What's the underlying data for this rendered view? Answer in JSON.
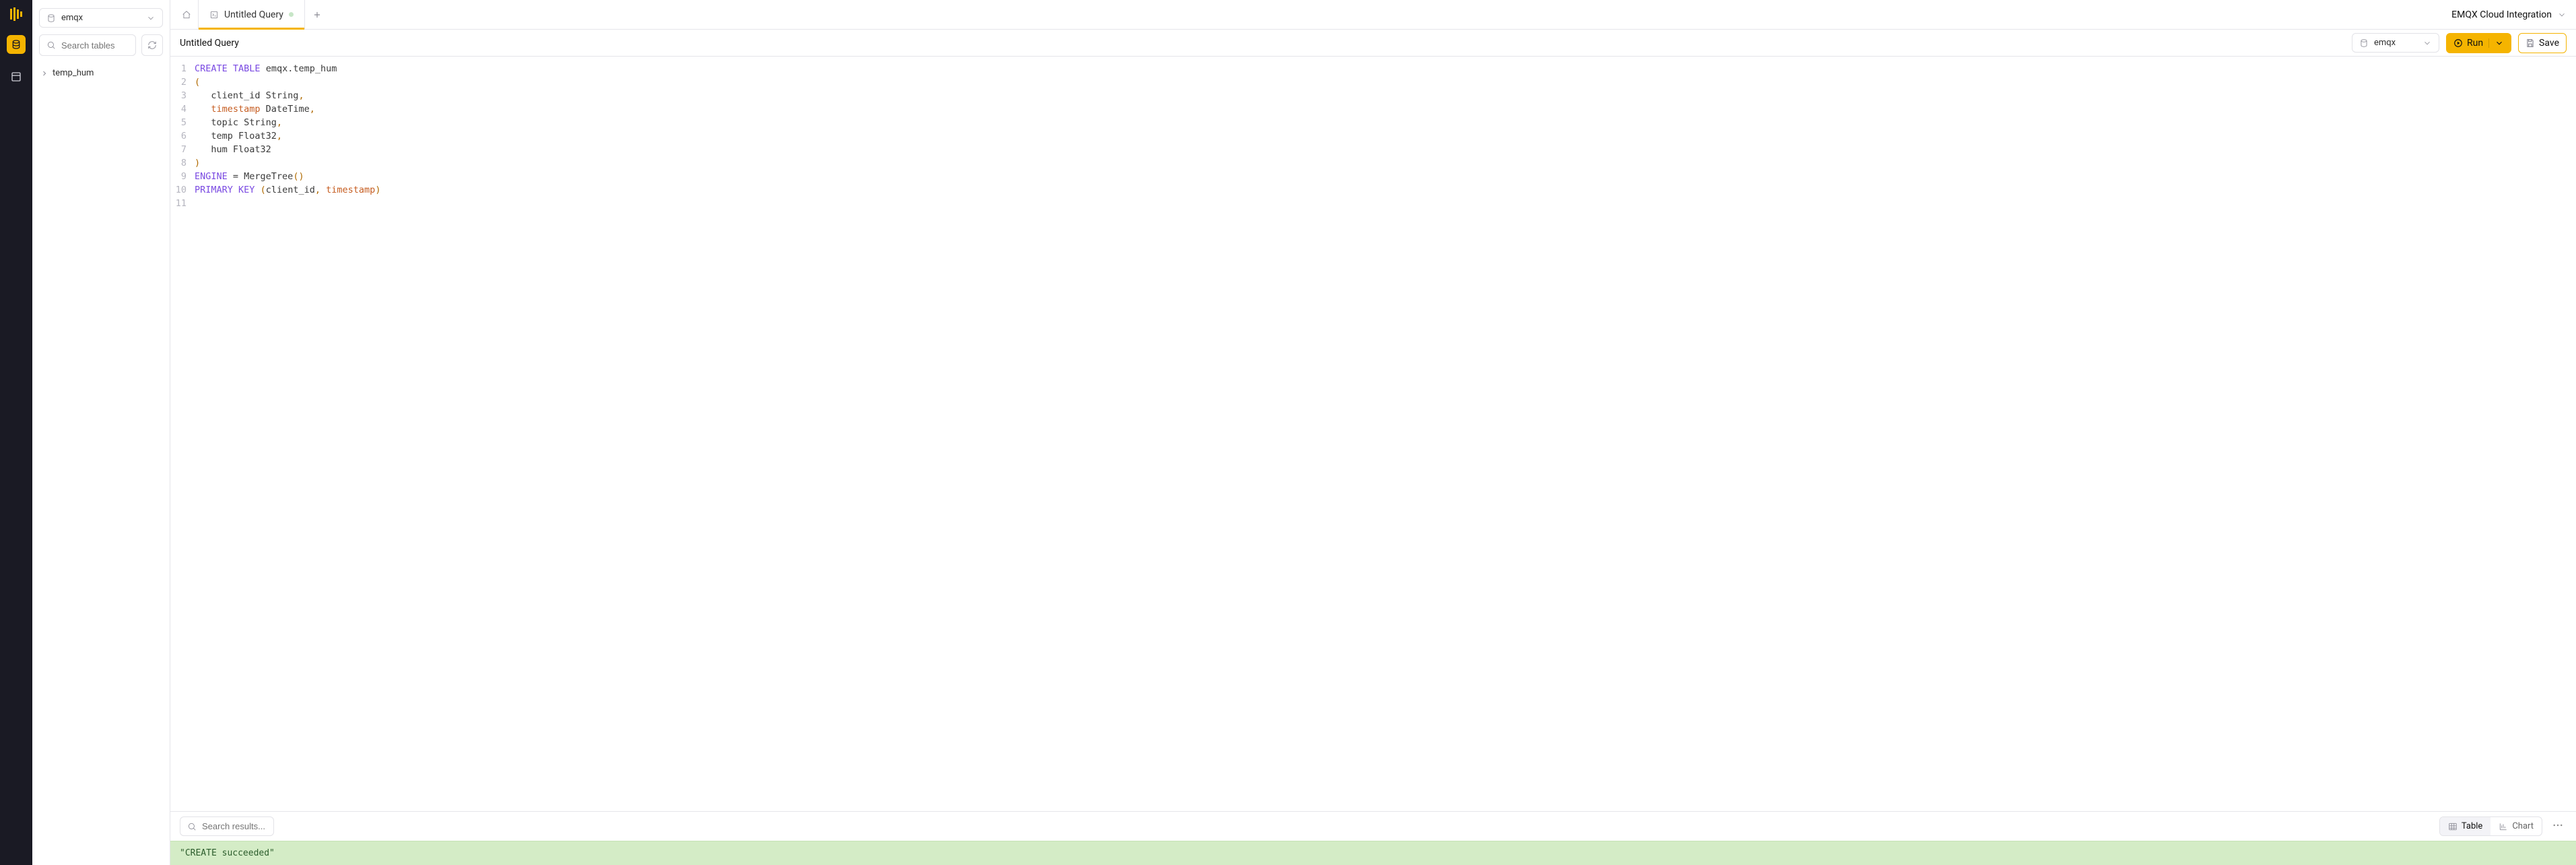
{
  "rail": {
    "icons": [
      "logo",
      "sql-console",
      "dashboards"
    ]
  },
  "sidebar": {
    "database": "emqx",
    "search_placeholder": "Search tables",
    "tables": [
      {
        "name": "temp_hum"
      }
    ]
  },
  "tabs": {
    "items": [
      {
        "label": "Untitled Query",
        "dirty": true
      }
    ],
    "right_label": "EMQX Cloud Integration"
  },
  "toolbar": {
    "title": "Untitled Query",
    "target_db": "emqx",
    "run_label": "Run",
    "save_label": "Save"
  },
  "editor": {
    "lines": [
      [
        {
          "t": "CREATE",
          "c": "kw"
        },
        {
          "t": " "
        },
        {
          "t": "TABLE",
          "c": "kw"
        },
        {
          "t": " emqx.temp_hum"
        }
      ],
      [
        {
          "t": "(",
          "c": "pn"
        }
      ],
      [
        {
          "t": "   client_id String"
        },
        {
          "t": ",",
          "c": "pn"
        }
      ],
      [
        {
          "t": "   "
        },
        {
          "t": "timestamp",
          "c": "fn"
        },
        {
          "t": " DateTime"
        },
        {
          "t": ",",
          "c": "pn"
        }
      ],
      [
        {
          "t": "   topic String"
        },
        {
          "t": ",",
          "c": "pn"
        }
      ],
      [
        {
          "t": "   temp Float32"
        },
        {
          "t": ",",
          "c": "pn"
        }
      ],
      [
        {
          "t": "   hum Float32"
        }
      ],
      [
        {
          "t": ")",
          "c": "pn"
        }
      ],
      [
        {
          "t": "ENGINE",
          "c": "kw"
        },
        {
          "t": " = MergeTree"
        },
        {
          "t": "()",
          "c": "pn"
        }
      ],
      [
        {
          "t": "PRIMARY",
          "c": "kw"
        },
        {
          "t": " "
        },
        {
          "t": "KEY",
          "c": "kw"
        },
        {
          "t": " "
        },
        {
          "t": "(",
          "c": "pn"
        },
        {
          "t": "client_id"
        },
        {
          "t": ",",
          "c": "pn"
        },
        {
          "t": " "
        },
        {
          "t": "timestamp",
          "c": "fn"
        },
        {
          "t": ")",
          "c": "pn"
        }
      ],
      []
    ]
  },
  "results": {
    "search_placeholder": "Search results...",
    "table_label": "Table",
    "chart_label": "Chart",
    "banner": "\"CREATE succeeded\""
  }
}
